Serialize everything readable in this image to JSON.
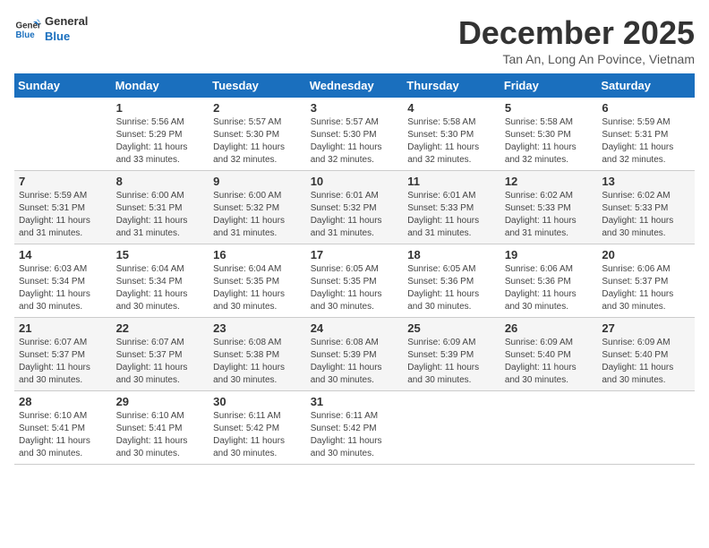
{
  "header": {
    "logo_line1": "General",
    "logo_line2": "Blue",
    "title": "December 2025",
    "subtitle": "Tan An, Long An Povince, Vietnam"
  },
  "weekdays": [
    "Sunday",
    "Monday",
    "Tuesday",
    "Wednesday",
    "Thursday",
    "Friday",
    "Saturday"
  ],
  "weeks": [
    [
      {
        "day": "",
        "info": ""
      },
      {
        "day": "1",
        "info": "Sunrise: 5:56 AM\nSunset: 5:29 PM\nDaylight: 11 hours\nand 33 minutes."
      },
      {
        "day": "2",
        "info": "Sunrise: 5:57 AM\nSunset: 5:30 PM\nDaylight: 11 hours\nand 32 minutes."
      },
      {
        "day": "3",
        "info": "Sunrise: 5:57 AM\nSunset: 5:30 PM\nDaylight: 11 hours\nand 32 minutes."
      },
      {
        "day": "4",
        "info": "Sunrise: 5:58 AM\nSunset: 5:30 PM\nDaylight: 11 hours\nand 32 minutes."
      },
      {
        "day": "5",
        "info": "Sunrise: 5:58 AM\nSunset: 5:30 PM\nDaylight: 11 hours\nand 32 minutes."
      },
      {
        "day": "6",
        "info": "Sunrise: 5:59 AM\nSunset: 5:31 PM\nDaylight: 11 hours\nand 32 minutes."
      }
    ],
    [
      {
        "day": "7",
        "info": "Sunrise: 5:59 AM\nSunset: 5:31 PM\nDaylight: 11 hours\nand 31 minutes."
      },
      {
        "day": "8",
        "info": "Sunrise: 6:00 AM\nSunset: 5:31 PM\nDaylight: 11 hours\nand 31 minutes."
      },
      {
        "day": "9",
        "info": "Sunrise: 6:00 AM\nSunset: 5:32 PM\nDaylight: 11 hours\nand 31 minutes."
      },
      {
        "day": "10",
        "info": "Sunrise: 6:01 AM\nSunset: 5:32 PM\nDaylight: 11 hours\nand 31 minutes."
      },
      {
        "day": "11",
        "info": "Sunrise: 6:01 AM\nSunset: 5:33 PM\nDaylight: 11 hours\nand 31 minutes."
      },
      {
        "day": "12",
        "info": "Sunrise: 6:02 AM\nSunset: 5:33 PM\nDaylight: 11 hours\nand 31 minutes."
      },
      {
        "day": "13",
        "info": "Sunrise: 6:02 AM\nSunset: 5:33 PM\nDaylight: 11 hours\nand 30 minutes."
      }
    ],
    [
      {
        "day": "14",
        "info": "Sunrise: 6:03 AM\nSunset: 5:34 PM\nDaylight: 11 hours\nand 30 minutes."
      },
      {
        "day": "15",
        "info": "Sunrise: 6:04 AM\nSunset: 5:34 PM\nDaylight: 11 hours\nand 30 minutes."
      },
      {
        "day": "16",
        "info": "Sunrise: 6:04 AM\nSunset: 5:35 PM\nDaylight: 11 hours\nand 30 minutes."
      },
      {
        "day": "17",
        "info": "Sunrise: 6:05 AM\nSunset: 5:35 PM\nDaylight: 11 hours\nand 30 minutes."
      },
      {
        "day": "18",
        "info": "Sunrise: 6:05 AM\nSunset: 5:36 PM\nDaylight: 11 hours\nand 30 minutes."
      },
      {
        "day": "19",
        "info": "Sunrise: 6:06 AM\nSunset: 5:36 PM\nDaylight: 11 hours\nand 30 minutes."
      },
      {
        "day": "20",
        "info": "Sunrise: 6:06 AM\nSunset: 5:37 PM\nDaylight: 11 hours\nand 30 minutes."
      }
    ],
    [
      {
        "day": "21",
        "info": "Sunrise: 6:07 AM\nSunset: 5:37 PM\nDaylight: 11 hours\nand 30 minutes."
      },
      {
        "day": "22",
        "info": "Sunrise: 6:07 AM\nSunset: 5:37 PM\nDaylight: 11 hours\nand 30 minutes."
      },
      {
        "day": "23",
        "info": "Sunrise: 6:08 AM\nSunset: 5:38 PM\nDaylight: 11 hours\nand 30 minutes."
      },
      {
        "day": "24",
        "info": "Sunrise: 6:08 AM\nSunset: 5:39 PM\nDaylight: 11 hours\nand 30 minutes."
      },
      {
        "day": "25",
        "info": "Sunrise: 6:09 AM\nSunset: 5:39 PM\nDaylight: 11 hours\nand 30 minutes."
      },
      {
        "day": "26",
        "info": "Sunrise: 6:09 AM\nSunset: 5:40 PM\nDaylight: 11 hours\nand 30 minutes."
      },
      {
        "day": "27",
        "info": "Sunrise: 6:09 AM\nSunset: 5:40 PM\nDaylight: 11 hours\nand 30 minutes."
      }
    ],
    [
      {
        "day": "28",
        "info": "Sunrise: 6:10 AM\nSunset: 5:41 PM\nDaylight: 11 hours\nand 30 minutes."
      },
      {
        "day": "29",
        "info": "Sunrise: 6:10 AM\nSunset: 5:41 PM\nDaylight: 11 hours\nand 30 minutes."
      },
      {
        "day": "30",
        "info": "Sunrise: 6:11 AM\nSunset: 5:42 PM\nDaylight: 11 hours\nand 30 minutes."
      },
      {
        "day": "31",
        "info": "Sunrise: 6:11 AM\nSunset: 5:42 PM\nDaylight: 11 hours\nand 30 minutes."
      },
      {
        "day": "",
        "info": ""
      },
      {
        "day": "",
        "info": ""
      },
      {
        "day": "",
        "info": ""
      }
    ]
  ]
}
